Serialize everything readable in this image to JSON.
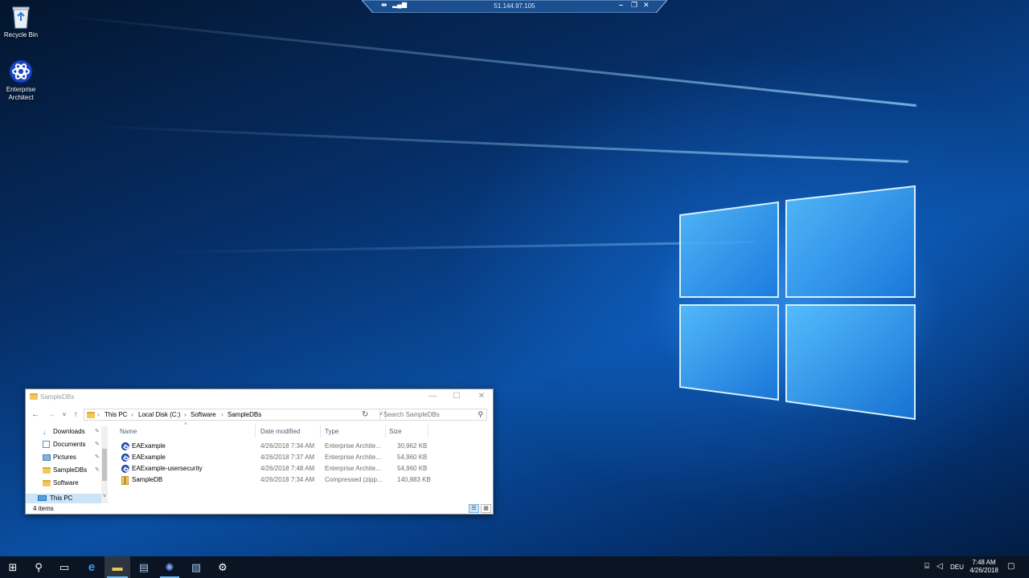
{
  "desktop": {
    "icons": [
      {
        "label": "Recycle Bin",
        "icon": "recycle-bin-icon"
      },
      {
        "label": "Enterprise Architect",
        "icon": "enterprise-architect-icon"
      }
    ]
  },
  "rdp_bar": {
    "host": "51.144.97.105",
    "controls": {
      "pin": "pin-icon",
      "signal": "connection-bars-icon",
      "minimize": "–",
      "restore": "❐",
      "close": "✕"
    }
  },
  "explorer": {
    "title": "SampleDBs",
    "window_controls": {
      "minimize": "—",
      "maximize": "☐",
      "close": "✕"
    },
    "nav_buttons": {
      "back": "←",
      "forward": "→",
      "recent": "˅",
      "up": "↑"
    },
    "breadcrumb": [
      "This PC",
      "Local Disk (C:)",
      "Software",
      "SampleDBs"
    ],
    "crumb_separator": "›",
    "address_dropdown": "˅",
    "refresh_glyph": "↻",
    "search_placeholder": "Search SampleDBs",
    "search_glyph": "⚲",
    "nav_pane": {
      "items": [
        {
          "label": "Downloads",
          "icon": "downloads-icon",
          "pinned": true
        },
        {
          "label": "Documents",
          "icon": "documents-icon",
          "pinned": true
        },
        {
          "label": "Pictures",
          "icon": "pictures-icon",
          "pinned": true
        },
        {
          "label": "SampleDBs",
          "icon": "folder-icon",
          "pinned": true
        },
        {
          "label": "Software",
          "icon": "folder-icon",
          "pinned": false
        },
        {
          "label": "This PC",
          "icon": "this-pc-icon",
          "pinned": false
        }
      ],
      "pin_glyph": "📌"
    },
    "columns": {
      "name": "Name",
      "date": "Date modified",
      "type": "Type",
      "size": "Size"
    },
    "sort_glyph": "^",
    "files": [
      {
        "name": "EAExample",
        "date": "4/26/2018 7:34 AM",
        "type": "Enterprise Archite...",
        "size": "30,962 KB",
        "icon": "enterprise-architect-file-icon"
      },
      {
        "name": "EAExample",
        "date": "4/26/2018 7:37 AM",
        "type": "Enterprise Archite...",
        "size": "54,960 KB",
        "icon": "enterprise-architect-file-icon"
      },
      {
        "name": "EAExample-usersecurity",
        "date": "4/26/2018 7:48 AM",
        "type": "Enterprise Archite...",
        "size": "54,960 KB",
        "icon": "enterprise-architect-file-icon"
      },
      {
        "name": "SampleDB",
        "date": "4/26/2018 7:34 AM",
        "type": "Compressed (zipp...",
        "size": "140,883 KB",
        "icon": "zip-folder-icon"
      }
    ],
    "status": "4 items"
  },
  "taskbar": {
    "buttons": [
      {
        "name": "start-button",
        "glyph": "⊞"
      },
      {
        "name": "search-button",
        "glyph": "⚲"
      },
      {
        "name": "task-view-button",
        "glyph": "▭"
      },
      {
        "name": "edge-button",
        "glyph": "e"
      },
      {
        "name": "file-explorer-button",
        "glyph": "▬"
      },
      {
        "name": "server-manager-button",
        "glyph": "▤"
      },
      {
        "name": "enterprise-architect-button",
        "glyph": "✺"
      },
      {
        "name": "remote-app-button",
        "glyph": "▧"
      },
      {
        "name": "settings-button",
        "glyph": "⚙"
      }
    ],
    "tray": {
      "language": "DEU",
      "time": "7:48 AM",
      "date": "4/26/2018",
      "notification_glyph": "▢"
    }
  },
  "colors": {
    "taskbar": "#0b1422",
    "accent": "#76b9ed",
    "selection": "#cce4f7"
  }
}
